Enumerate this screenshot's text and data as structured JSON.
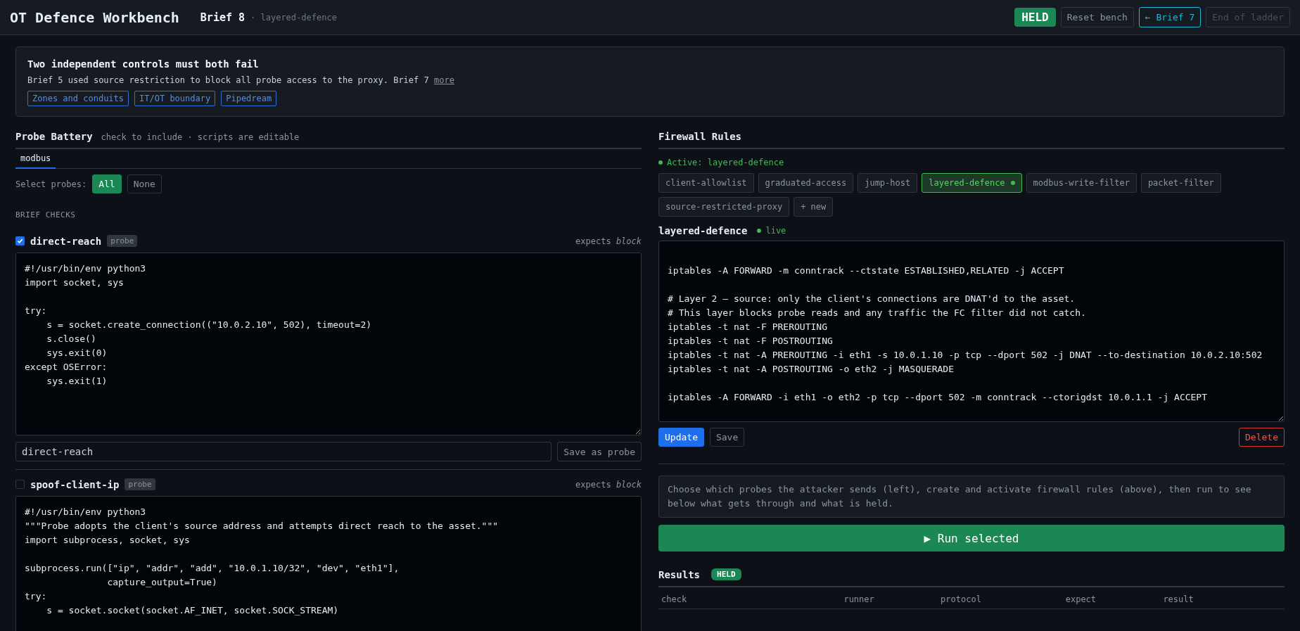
{
  "header": {
    "title": "OT Defence Workbench",
    "brief": "Brief 8",
    "subtitle": "· layered-defence",
    "status": {
      "label": "HELD",
      "kind": "held"
    },
    "buttons": [
      {
        "label": "Reset bench",
        "kind": "plain"
      },
      {
        "label": "← Brief 7",
        "kind": "nav"
      },
      {
        "label": "End of ladder",
        "kind": "disabled"
      }
    ]
  },
  "brief": {
    "title": "Two independent controls must both fail",
    "text": "Brief 5 used source restriction to block all probe access to the proxy. Brief 7",
    "more": "more",
    "tags": [
      "Zones and conduits",
      "IT/OT boundary",
      "Pipedream"
    ]
  },
  "probe_battery": {
    "title": "Probe Battery",
    "hint": "check to include · scripts are editable",
    "tabs": [
      {
        "label": "modbus",
        "selected": true
      }
    ],
    "select_label": "Select probes:",
    "select_options": [
      {
        "label": "All",
        "selected": true
      },
      {
        "label": "None",
        "selected": false
      }
    ],
    "section": "BRIEF CHECKS",
    "probes": [
      {
        "name": "direct-reach",
        "badge": "probe",
        "checked": true,
        "expects": "expects *block*",
        "script": "#!/usr/bin/env python3\nimport socket, sys\n\ntry:\n    s = socket.create_connection((\"10.0.2.10\", 502), timeout=2)\n    s.close()\n    sys.exit(0)\nexcept OSError:\n    sys.exit(1)",
        "save_name": "direct-reach",
        "save_label": "Save as probe"
      },
      {
        "name": "spoof-client-ip",
        "badge": "probe",
        "checked": false,
        "expects": "expects *block*",
        "script": "#!/usr/bin/env python3\n\"\"\"Probe adopts the client's source address and attempts direct reach to the asset.\"\"\"\nimport subprocess, socket, sys\n\nsubprocess.run([\"ip\", \"addr\", \"add\", \"10.0.1.10/32\", \"dev\", \"eth1\"],\n               capture_output=True)\ntry:\n    s = socket.socket(socket.AF_INET, socket.SOCK_STREAM)"
      }
    ]
  },
  "firewall": {
    "title": "Firewall Rules",
    "active": "Active: layered-defence",
    "rules": [
      {
        "label": "client-allowlist",
        "selected": false
      },
      {
        "label": "graduated-access",
        "selected": false
      },
      {
        "label": "jump-host",
        "selected": false
      },
      {
        "label": "layered-defence",
        "selected": true
      },
      {
        "label": "modbus-write-filter",
        "selected": false
      },
      {
        "label": "packet-filter",
        "selected": false
      },
      {
        "label": "source-restricted-proxy",
        "selected": false
      },
      {
        "label": "+ new",
        "selected": false
      }
    ],
    "editor_title": "layered-defence",
    "live": "live",
    "script": "\niptables -A FORWARD -m conntrack --ctstate ESTABLISHED,RELATED -j ACCEPT\n\n# Layer 2 — source: only the client's connections are DNAT'd to the asset.\n# This layer blocks probe reads and any traffic the FC filter did not catch.\niptables -t nat -F PREROUTING\niptables -t nat -F POSTROUTING\niptables -t nat -A PREROUTING -i eth1 -s 10.0.1.10 -p tcp --dport 502 -j DNAT --to-destination 10.0.2.10:502\niptables -t nat -A POSTROUTING -o eth2 -j MASQUERADE\n\niptables -A FORWARD -i eth1 -o eth2 -p tcp --dport 502 -m conntrack --ctorigdst 10.0.1.1 -j ACCEPT",
    "update": "Update",
    "save": "Save",
    "delete": "Delete",
    "info": "Choose which probes the attacker sends (left), create and activate firewall rules (above), then run to see below what gets through and what is held.",
    "run": "▶ Run selected"
  },
  "results": {
    "title": "Results",
    "status": {
      "label": "HELD",
      "kind": "held"
    },
    "columns": [
      "check",
      "runner",
      "protocol",
      "expect",
      "result"
    ]
  }
}
